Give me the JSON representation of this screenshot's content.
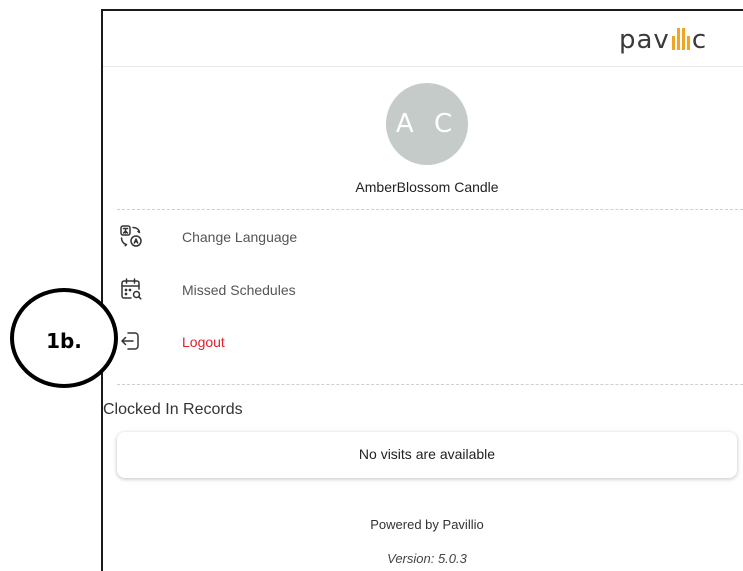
{
  "header": {
    "logo_text_start": "pav",
    "logo_text_end": "c"
  },
  "profile": {
    "initials": "A C",
    "name": "AmberBlossom Candle"
  },
  "menu": {
    "items": [
      {
        "label": "Change Language",
        "icon": "translate-icon"
      },
      {
        "label": "Missed Schedules",
        "icon": "calendar-search-icon"
      },
      {
        "label": "Logout",
        "icon": "logout-icon"
      }
    ]
  },
  "clocked_in": {
    "title": "Clocked In Records",
    "empty_message": "No visits are available"
  },
  "footer": {
    "powered_by": "Powered by Pavillio",
    "version": "Version: 5.0.3"
  },
  "annotation": {
    "label": "1b."
  },
  "colors": {
    "logout": "#e0202a",
    "logo_accent": "#f0a526",
    "avatar_bg": "#c5cbc9"
  }
}
